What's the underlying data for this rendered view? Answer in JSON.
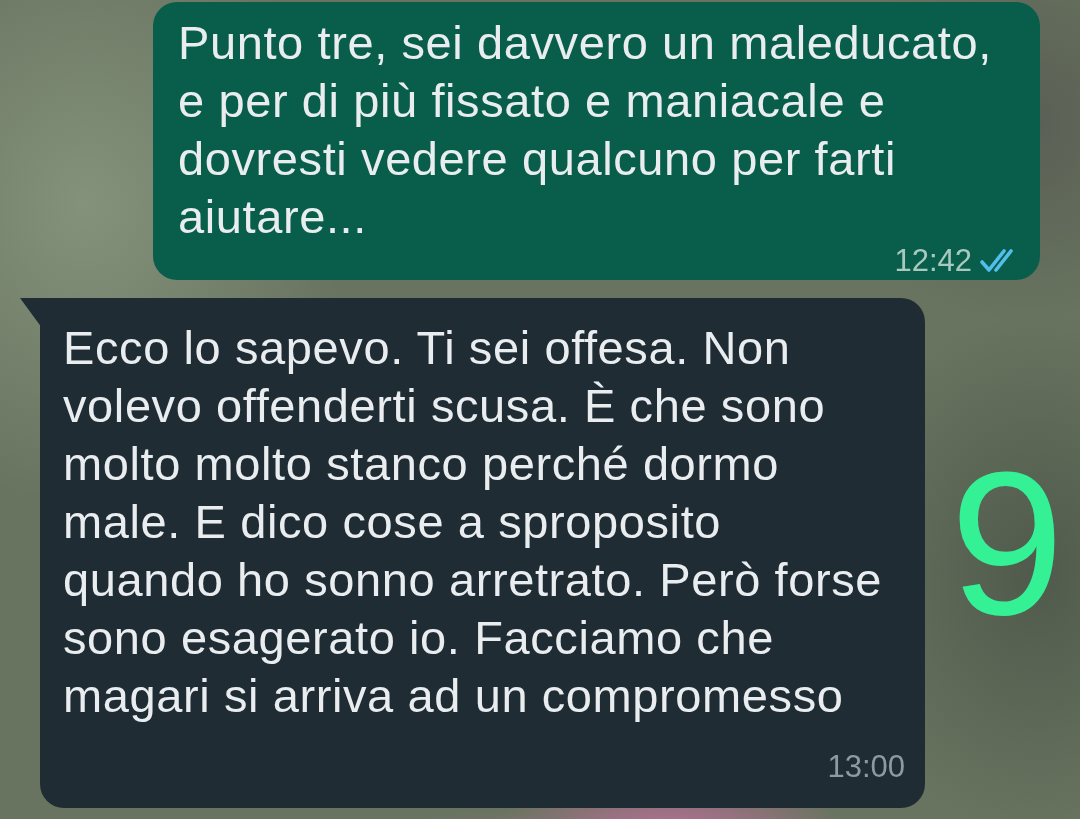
{
  "messages": [
    {
      "kind": "outgoing",
      "text": "Punto tre, sei davvero un maleducato, e per di più fissato e maniacale e dovresti vedere qualcuno per farti aiutare...",
      "time": "12:42",
      "read": true
    },
    {
      "kind": "incoming",
      "text": "Ecco lo sapevo. Ti sei offesa. Non volevo offenderti scusa. È che sono molto molto stanco perché dormo male. E dico cose a sproposito quando ho sonno arretrato. Però forse sono esagerato io. Facciamo che magari si arriva ad un compromesso",
      "time": "13:00"
    }
  ],
  "annotation": {
    "text": "9"
  }
}
